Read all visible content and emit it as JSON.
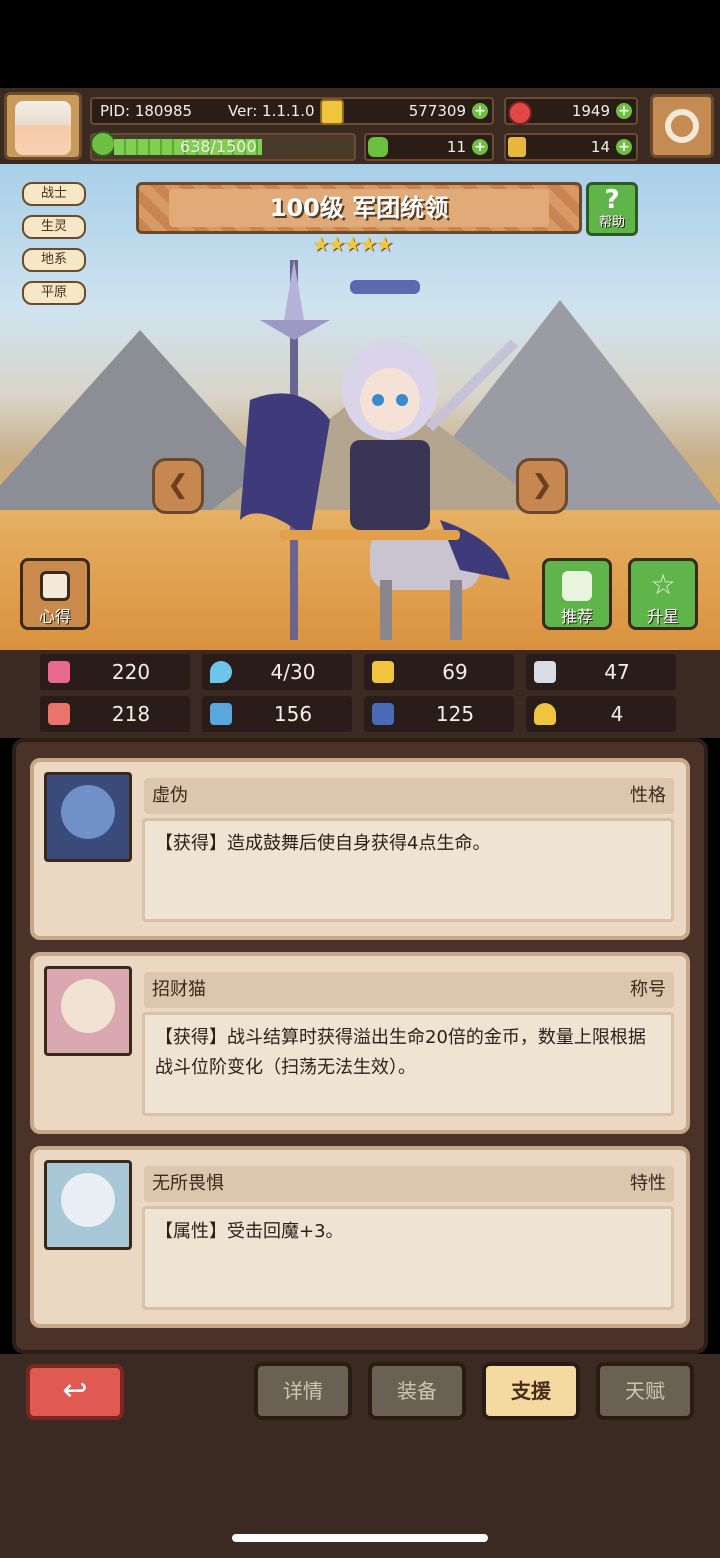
{
  "player": {
    "pid": "PID: 180985",
    "version": "Ver: 1.1.1.0",
    "exp": "638/1500",
    "gold": "577309",
    "gems": "1949",
    "clover": "11",
    "keys": "14",
    "exp_fraction": 0.425
  },
  "tags": [
    "战士",
    "生灵",
    "地系",
    "平原"
  ],
  "hero": {
    "title": "100级 军团统领",
    "stars": "★★★★★",
    "help_label": "帮助",
    "help_icon": "?"
  },
  "side_buttons": {
    "notes": "心得",
    "recommend": "推荐",
    "star_up": "升星"
  },
  "stats": {
    "hp": "220",
    "mana": "4/30",
    "armor": "69",
    "speed": "47",
    "attack": "218",
    "magic": "156",
    "defense": "125",
    "luck": "4"
  },
  "cards": [
    {
      "name": "虚伪",
      "type": "性格",
      "desc": "【获得】造成鼓舞后使自身获得4点生命。",
      "stars": "★★★"
    },
    {
      "name": "招财猫",
      "type": "称号",
      "desc": "【获得】战斗结算时获得溢出生命20倍的金币，数量上限根据战斗位阶变化（扫荡无法生效）。",
      "stars": "★★★★"
    },
    {
      "name": "无所畏惧",
      "type": "特性",
      "desc": "【属性】受击回魔+3。",
      "stars": "★★★★★"
    }
  ],
  "nav": {
    "back_icon": "↩",
    "details": "详情",
    "equipment": "装备",
    "support": "支援",
    "talent": "天赋"
  },
  "colors": {
    "accent_green": "#6dbf3f",
    "active_tab": "#f4d9a0",
    "back_red": "#e05a52"
  }
}
